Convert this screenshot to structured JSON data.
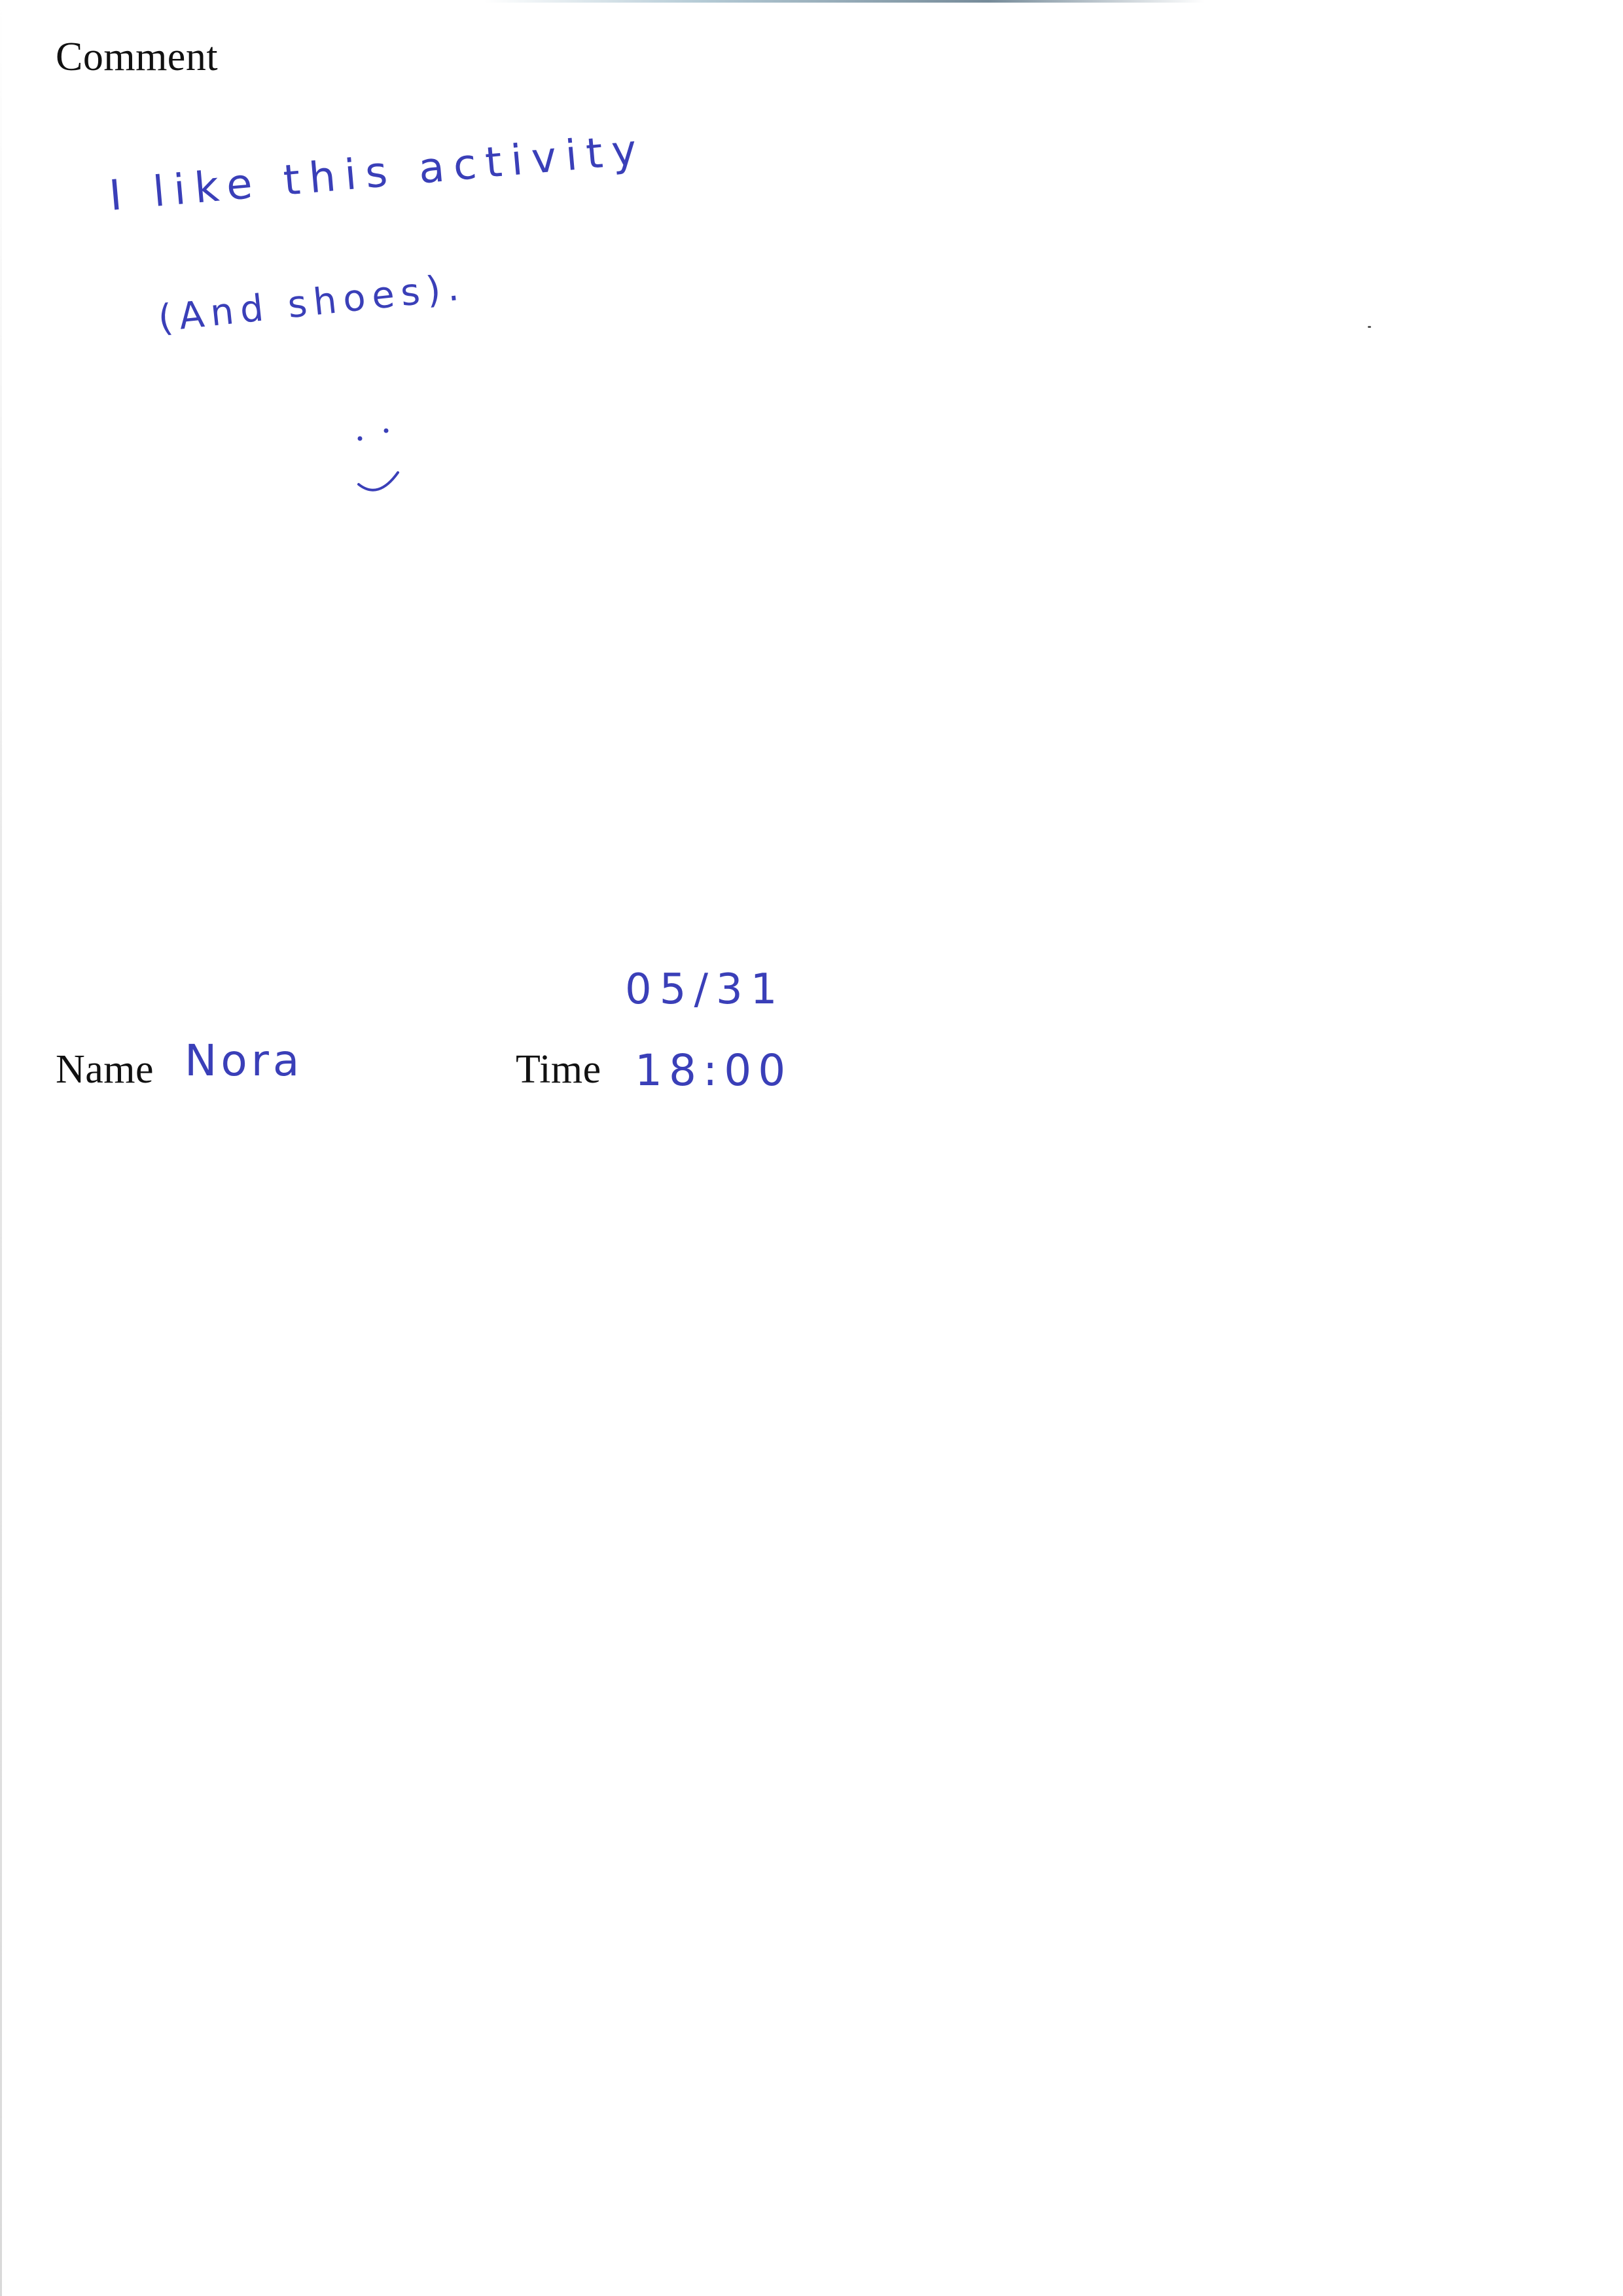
{
  "form": {
    "comment_heading": "Comment",
    "name_label": "Name",
    "time_label": "Time"
  },
  "handwritten": {
    "comment_line_1": "I like this activity",
    "comment_line_2": "(And shoes).",
    "name": "Nora",
    "date": "05/31",
    "time": "18:00",
    "drawing": "smiley-face-icon"
  },
  "colors": {
    "ink": "#3a3fb8",
    "print": "#111111"
  }
}
